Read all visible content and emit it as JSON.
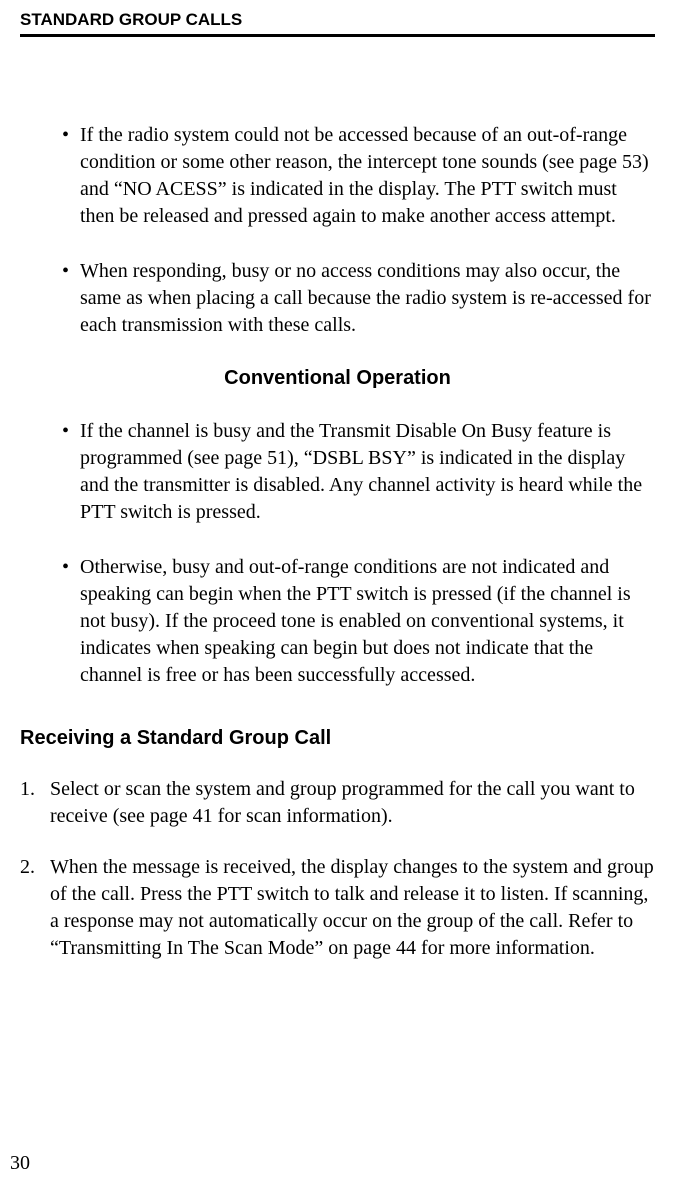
{
  "header": {
    "title": "STANDARD GROUP CALLS"
  },
  "bullets_top": [
    "If the radio system could not be accessed because of an out-of-range condition or some other reason, the intercept tone sounds (see page 53) and “NO ACESS” is indicated in the display. The PTT switch must then be released and pressed again to make another access attempt.",
    "When responding, busy or no access conditions may also occur, the same as when placing a call because the radio system is re-accessed for each transmission with these calls."
  ],
  "subsection_heading": "Conventional Operation",
  "bullets_conventional": [
    "If the channel is busy and the Transmit Disable On Busy feature is programmed (see page 51), “DSBL BSY” is indicated in the display and the transmitter is disabled. Any channel activity is heard while the PTT switch is pressed.",
    "Otherwise, busy and out-of-range conditions are not indicated and speaking can begin when the PTT switch is pressed (if the channel is not busy). If the proceed tone is enabled on conventional systems, it indicates when speaking can begin but does not indicate that the channel is free or has been successfully accessed."
  ],
  "section_heading": "Receiving a Standard Group Call",
  "steps": [
    "Select or scan the system and group programmed for the call you want to receive (see page 41 for scan information).",
    "When the message is received, the display changes to the system and group of the call. Press the PTT switch to talk and release it to listen. If scanning, a response may not automatically occur on the group of the call. Refer to “Transmitting In The Scan Mode” on page 44 for more information."
  ],
  "page_number": "30"
}
